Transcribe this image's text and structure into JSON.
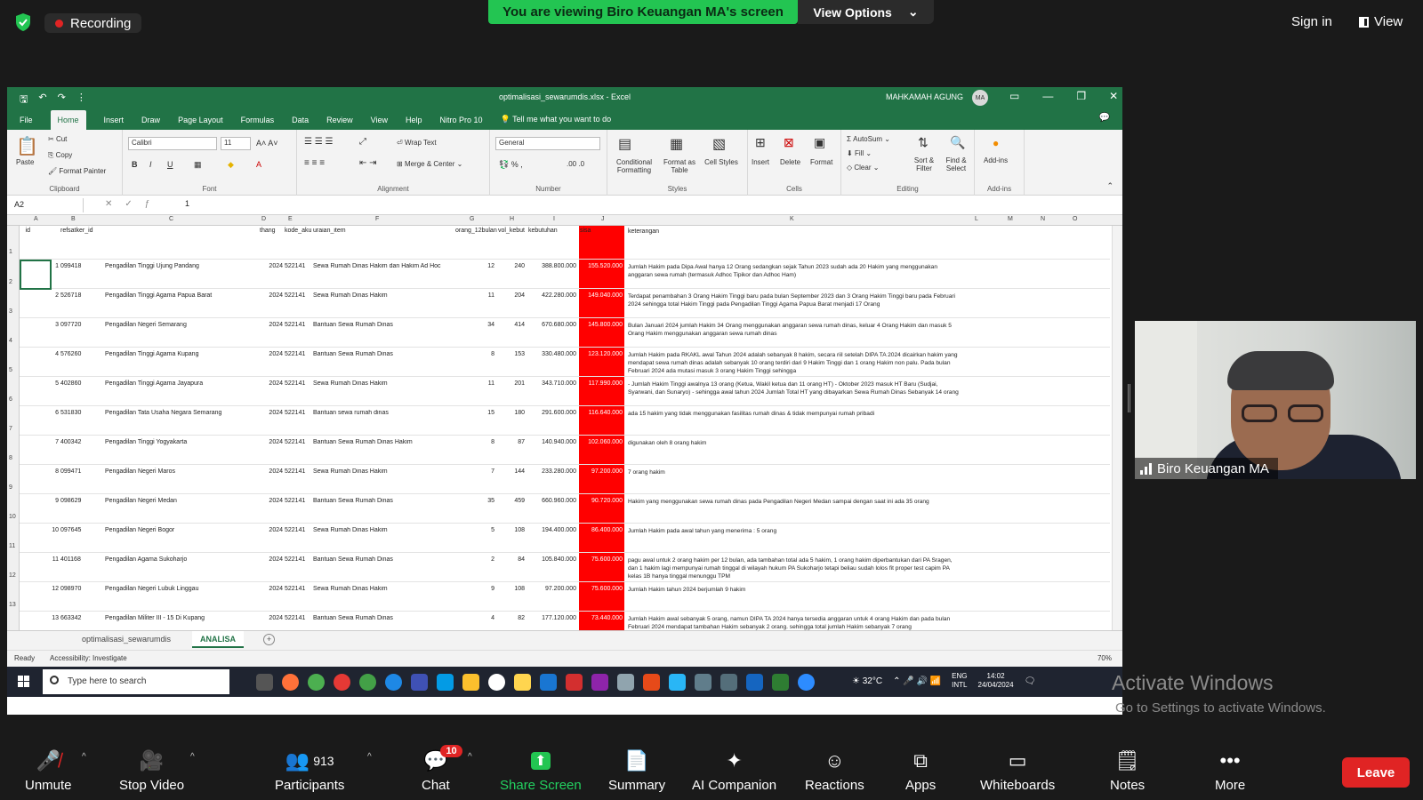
{
  "zoom": {
    "recording": "Recording",
    "banner": "You are viewing Biro Keuangan MA's screen",
    "view_options": "View Options",
    "sign_in": "Sign in",
    "view": "View",
    "participant_name": "Biro Keuangan MA",
    "toolbar": {
      "unmute": "Unmute",
      "stop_video": "Stop Video",
      "participants": "Participants",
      "participants_count": "913",
      "chat": "Chat",
      "chat_badge": "10",
      "share_screen": "Share Screen",
      "summary": "Summary",
      "ai_companion": "AI Companion",
      "reactions": "Reactions",
      "apps": "Apps",
      "whiteboards": "Whiteboards",
      "notes": "Notes",
      "more": "More",
      "leave": "Leave"
    },
    "watermark": {
      "line1": "Activate Windows",
      "line2": "Go to Settings to activate Windows."
    }
  },
  "excel": {
    "filename": "optimalisasi_sewarumdis.xlsx  -  Excel",
    "org": "MAHKAMAH AGUNG",
    "avatar": "MA",
    "tabs": [
      "File",
      "Home",
      "Insert",
      "Draw",
      "Page Layout",
      "Formulas",
      "Data",
      "Review",
      "View",
      "Help",
      "Nitro Pro 10"
    ],
    "tell_me": "Tell me what you want to do",
    "ribbon": {
      "cut": "Cut",
      "copy": "Copy",
      "format_painter": "Format Painter",
      "paste": "Paste",
      "clipboard": "Clipboard",
      "font_name": "Calibri",
      "font_size": "11",
      "font": "Font",
      "wrap_text": "Wrap Text",
      "merge_center": "Merge & Center",
      "alignment": "Alignment",
      "number_format": "General",
      "number": "Number",
      "cond_format": "Conditional Formatting",
      "format_table": "Format as Table",
      "cell_styles": "Cell Styles",
      "styles": "Styles",
      "insert": "Insert",
      "delete": "Delete",
      "format": "Format",
      "cells": "Cells",
      "autosum": "AutoSum",
      "fill": "Fill",
      "clear": "Clear",
      "sort_filter": "Sort & Filter",
      "find_select": "Find & Select",
      "editing": "Editing",
      "addins": "Add-ins",
      "addins_group": "Add-ins"
    },
    "name_box": "A2",
    "formula_value": "1",
    "columns": [
      "A",
      "B",
      "C",
      "D",
      "E",
      "F",
      "G",
      "H",
      "I",
      "J",
      "K",
      "L",
      "M",
      "N",
      "O"
    ],
    "headers": {
      "id": "id",
      "satker": "refsatker_id",
      "thn": "thang",
      "kode": "kode_aku",
      "urai": "uraian_item",
      "org": "orang_12bulan",
      "vol": "vol_kebut",
      "keb": "kebutuhan",
      "sisa": "sisa",
      "ket": "keterangan"
    },
    "rows": [
      {
        "id": "1",
        "satker": "099418",
        "name": "Pengadilan Tinggi Ujung Pandang",
        "thn": "2024",
        "kode": "522141",
        "urai": "Sewa Rumah Dinas Hakim dan Hakim Ad Hoc",
        "org": "12",
        "vol": "240",
        "keb": "388.800.000",
        "sisa": "155.520.000",
        "ket": "Jumlah Hakim pada Dipa Awal hanya 12 Orang sedangkan sejak Tahun 2023 sudah ada 20 Hakim yang menggunakan anggaran sewa rumah (termasuk Adhoc Tipikor dan Adhoc Ham)"
      },
      {
        "id": "2",
        "satker": "526718",
        "name": "Pengadilan Tinggi Agama Papua Barat",
        "thn": "2024",
        "kode": "522141",
        "urai": "Sewa Rumah Dinas Hakim",
        "org": "11",
        "vol": "204",
        "keb": "422.280.000",
        "sisa": "149.040.000",
        "ket": "Terdapat penambahan 3 Orang Hakim Tinggi baru pada bulan September 2023 dan 3 Orang Hakim Tinggi baru pada Februari 2024 sehingga total Hakim Tinggi pada Pengadilan Tinggi Agama Papua Barat menjadi 17 Orang"
      },
      {
        "id": "3",
        "satker": "097720",
        "name": "Pengadilan Negeri Semarang",
        "thn": "2024",
        "kode": "522141",
        "urai": "Bantuan Sewa Rumah Dinas",
        "org": "34",
        "vol": "414",
        "keb": "670.680.000",
        "sisa": "145.800.000",
        "ket": "Bulan Januari 2024 jumlah Hakim 34 Orang menggunakan anggaran sewa rumah dinas, keluar 4 Orang Hakim dan masuk 5 Orang Hakim menggunakan anggaran sewa rumah dinas"
      },
      {
        "id": "4",
        "satker": "576260",
        "name": "Pengadilan Tinggi Agama Kupang",
        "thn": "2024",
        "kode": "522141",
        "urai": "Bantuan Sewa Rumah Dinas",
        "org": "8",
        "vol": "153",
        "keb": "330.480.000",
        "sisa": "123.120.000",
        "ket": "Jumlah Hakim pada RKAKL awal Tahun 2024 adalah sebanyak 8 hakim, secara riil setelah DIPA TA 2024 dicairkan hakim yang mendapat sewa rumah dinas adalah sebanyak 10 orang terdiri dari 9 Hakim Tinggi dan 1 orang Hakim non palu. Pada bulan Februari 2024 ada mutasi masuk 3 orang Hakim Tinggi sehingga"
      },
      {
        "id": "5",
        "satker": "402860",
        "name": "Pengadilan Tinggi Agama Jayapura",
        "thn": "2024",
        "kode": "522141",
        "urai": "Sewa Rumah Dinas Hakim",
        "org": "11",
        "vol": "201",
        "keb": "343.710.000",
        "sisa": "117.990.000",
        "ket": "- Jumlah Hakim Tinggi awalnya 13 orang (Ketua, Wakil ketua dan 11 orang HT) - Oktober 2023 masuk HT Baru (Sudjai, Syarwani, dan Sunaryo) - sehingga awal tahun 2024 Jumlah Total HT yang dibayarkan Sewa Rumah Dinas Sebanyak 14 orang"
      },
      {
        "id": "6",
        "satker": "531830",
        "name": "Pengadilan Tata Usaha Negara Semarang",
        "thn": "2024",
        "kode": "522141",
        "urai": "Bantuan sewa rumah dinas",
        "org": "15",
        "vol": "180",
        "keb": "291.600.000",
        "sisa": "116.640.000",
        "ket": "ada 15 hakim yang tidak menggunakan fasilitas rumah dinas & tidak mempunyai rumah pribadi"
      },
      {
        "id": "7",
        "satker": "400342",
        "name": "Pengadilan Tinggi Yogyakarta",
        "thn": "2024",
        "kode": "522141",
        "urai": "Bantuan Sewa Rumah Dinas Hakim",
        "org": "8",
        "vol": "87",
        "keb": "140.940.000",
        "sisa": "102.060.000",
        "ket": "digunakan oleh 8 orang hakim"
      },
      {
        "id": "8",
        "satker": "099471",
        "name": "Pengadilan Negeri Maros",
        "thn": "2024",
        "kode": "522141",
        "urai": "Sewa Rumah Dinas Hakim",
        "org": "7",
        "vol": "144",
        "keb": "233.280.000",
        "sisa": "97.200.000",
        "ket": "7 orang hakim"
      },
      {
        "id": "9",
        "satker": "098629",
        "name": "Pengadilan Negeri Medan",
        "thn": "2024",
        "kode": "522141",
        "urai": "Bantuan Sewa Rumah Dinas",
        "org": "35",
        "vol": "459",
        "keb": "660.960.000",
        "sisa": "90.720.000",
        "ket": "Hakim yang menggunakan sewa rumah dinas pada Pengadilan Negeri Medan sampai dengan saat ini ada 35 orang"
      },
      {
        "id": "10",
        "satker": "097645",
        "name": "Pengadilan Negeri Bogor",
        "thn": "2024",
        "kode": "522141",
        "urai": "Sewa Rumah Dinas Hakim",
        "org": "5",
        "vol": "108",
        "keb": "194.400.000",
        "sisa": "86.400.000",
        "ket": "Jumlah Hakim pada awal tahun yang menerima : 5 orang"
      },
      {
        "id": "11",
        "satker": "401168",
        "name": "Pengadilan Agama Sukoharjo",
        "thn": "2024",
        "kode": "522141",
        "urai": "Bantuan Sewa Rumah Dinas",
        "org": "2",
        "vol": "84",
        "keb": "105.840.000",
        "sisa": "75.600.000",
        "ket": "pagu awal untuk 2 orang hakim per 12 bulan, ada tambahan total ada 5 hakim, 1 orang hakim diperbantukan dari PA Sragen, dan 1 hakim lagi mempunyai rumah tinggal di wilayah hukum PA Sukoharjo tetapi beliau sudah lolos fit proper test capim PA kelas 1B hanya tinggal menunggu TPM"
      },
      {
        "id": "12",
        "satker": "098970",
        "name": "Pengadilan Negeri Lubuk Linggau",
        "thn": "2024",
        "kode": "522141",
        "urai": "Sewa Rumah Dinas Hakim",
        "org": "9",
        "vol": "108",
        "keb": "97.200.000",
        "sisa": "75.600.000",
        "ket": "Jumlah Hakim tahun 2024 berjumlah 9 hakim"
      },
      {
        "id": "13",
        "satker": "663342",
        "name": "Pengadilan Militer III - 15 Di Kupang",
        "thn": "2024",
        "kode": "522141",
        "urai": "Bantuan Sewa Rumah Dinas",
        "org": "4",
        "vol": "82",
        "keb": "177.120.000",
        "sisa": "73.440.000",
        "ket": "Jumlah Hakim awal sebanyak 5 orang, namun DIPA TA 2024 hanya tersedia anggaran untuk 4 orang Hakim dan pada bulan Februari 2024 mendapat tambahan Hakim sebanyak 2 orang. sehingga total jumlah Hakim sebanyak 7 orang"
      }
    ],
    "sheet_tab_1": "optimalisasi_sewarumdis",
    "sheet_tab_2": "ANALISA",
    "status_ready": "Ready",
    "accessibility": "Accessibility: Investigate",
    "zoom_level": "70%"
  },
  "taskbar": {
    "search_placeholder": "Type here to search",
    "temp": "32°C",
    "lang1": "ENG",
    "lang2": "INTL",
    "time": "14:02",
    "date": "24/04/2024"
  }
}
